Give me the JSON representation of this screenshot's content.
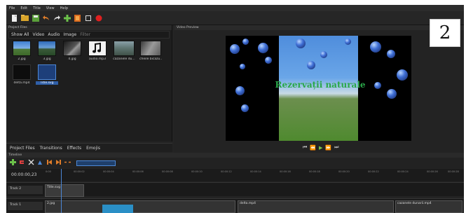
{
  "menu": [
    "File",
    "Edit",
    "Title",
    "View",
    "Help"
  ],
  "toolbar_icons": [
    "new-file-icon",
    "open-folder-icon",
    "save-icon",
    "undo-icon",
    "redo-icon",
    "add-icon",
    "export-icon",
    "fullscreen-icon",
    "record-icon"
  ],
  "project_files": {
    "title": "Project Files",
    "filters": [
      "Show All",
      "Video",
      "Audio",
      "Image"
    ],
    "filter_placeholder": "Filter",
    "files": [
      {
        "name": "2.jpg",
        "kind": "image"
      },
      {
        "name": "3.jpg",
        "kind": "image"
      },
      {
        "name": "4.jpg",
        "kind": "image"
      },
      {
        "name": "audio.mp3",
        "kind": "audio"
      },
      {
        "name": "cazanele du...",
        "kind": "video"
      },
      {
        "name": "cheile bicazu...",
        "kind": "video"
      },
      {
        "name": "delta.mp4",
        "kind": "video"
      },
      {
        "name": "Title.svg",
        "kind": "title",
        "selected": true
      }
    ]
  },
  "video_preview": {
    "title": "Video Preview",
    "overlay_text": "Rezervații naturale"
  },
  "badge": "2",
  "tabs": [
    "Project Files",
    "Transitions",
    "Effects",
    "Emojis"
  ],
  "timeline": {
    "title": "Timeline",
    "timecode": "00:00:00,23",
    "ruler": [
      "0:00",
      "00:00:02",
      "00:00:04",
      "00:00:06",
      "00:00:08",
      "00:00:10",
      "00:00:12",
      "00:00:14",
      "00:00:16",
      "00:00:18",
      "00:00:20",
      "00:00:22",
      "00:00:24",
      "00:00:26",
      "00:00:28"
    ],
    "tracks": [
      {
        "name": "Track 2",
        "clips": [
          "Title.svg"
        ]
      },
      {
        "name": "Track 1",
        "clips": [
          "2.jpg",
          "delta.mp4",
          "cazanele dunarii.mp4"
        ]
      }
    ]
  },
  "colors": {
    "accent": "#4c87d6",
    "play": "#7bc242",
    "overlay_text": "#2aa84a",
    "record": "#e02020"
  }
}
